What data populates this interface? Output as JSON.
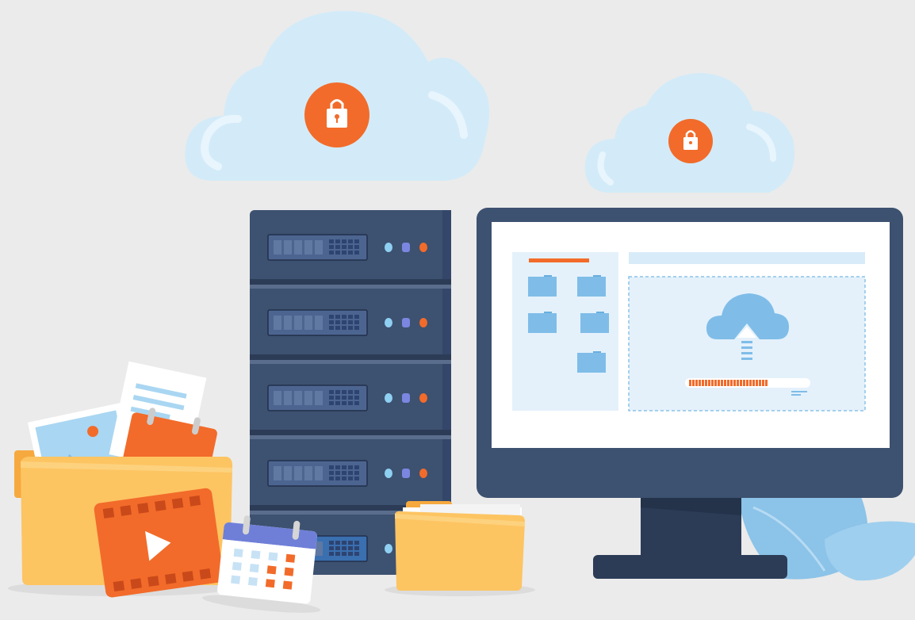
{
  "scene": {
    "background": "#ebebeb",
    "colors": {
      "cloud": "#d3ebf8",
      "cloud_highlight": "#e8f5fd",
      "accent_orange": "#f26b2a",
      "server_body": "#3d5170",
      "server_dark": "#2c3c57",
      "folder_yellow": "#fdc462",
      "folder_back": "#f6a93e",
      "leaf_blue": "#8cc3e8",
      "ui_light_blue": "#e4f1fb",
      "ui_folder_blue": "#7fbde8"
    },
    "clouds": [
      {
        "icon": "lock-icon"
      },
      {
        "icon": "lock-icon"
      }
    ],
    "server": {
      "units": 5,
      "leds": [
        "light-blue",
        "purple",
        "orange"
      ]
    },
    "monitor": {
      "window": {
        "sidebar_folder_count": 5,
        "upload_icon": "cloud-upload-icon",
        "upload_progress": 0.65
      }
    },
    "desk_items": [
      "folder-with-media",
      "film-clip-icon",
      "calendar-icon",
      "document-folder"
    ]
  }
}
